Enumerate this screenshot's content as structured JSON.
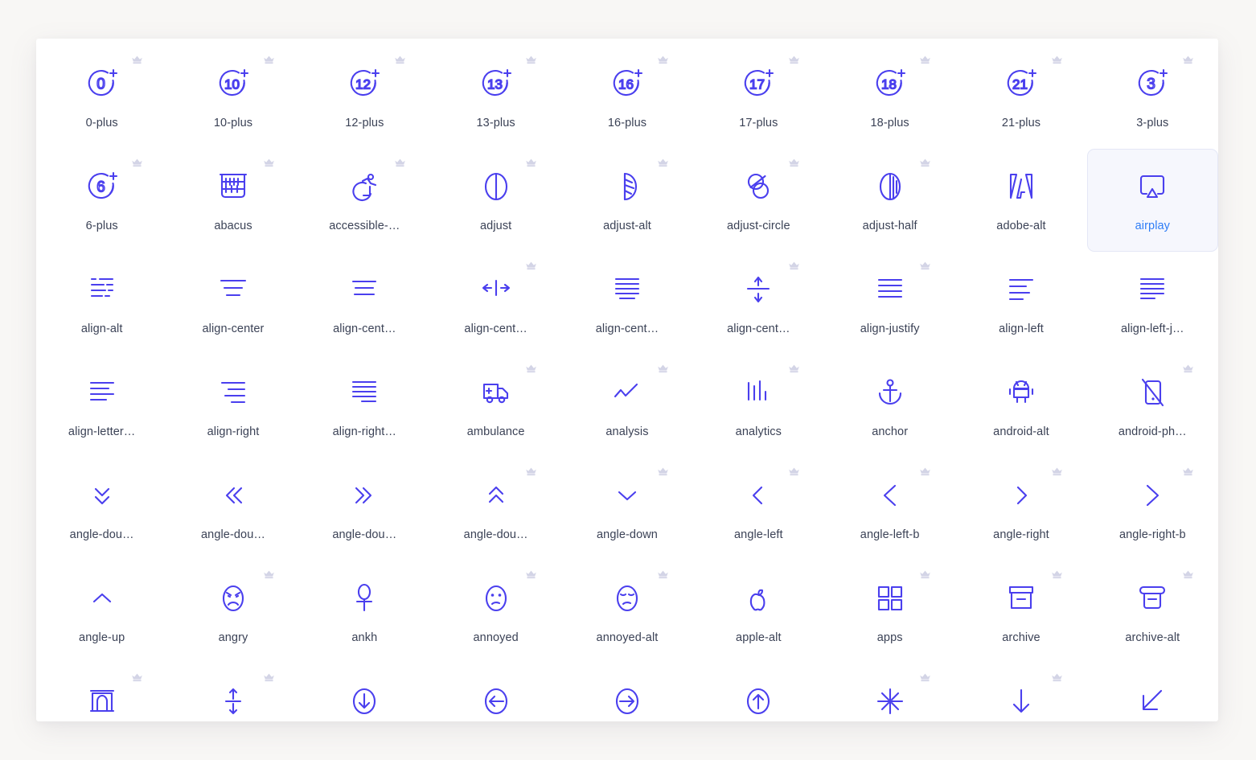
{
  "page": {
    "background_color": "#f8f7f5",
    "card_background": "#ffffff",
    "icon_color": "#4a3fee",
    "label_color": "#3b4256",
    "selected_label_color": "#2f7df6",
    "selected_background": "#f6f7fd",
    "crown_color": "#d3d4e6",
    "columns": 9
  },
  "icons": [
    {
      "label": "0-plus",
      "glyph": "age-plus",
      "value": "0",
      "premium": true,
      "selected": false
    },
    {
      "label": "10-plus",
      "glyph": "age-plus",
      "value": "10",
      "premium": true,
      "selected": false
    },
    {
      "label": "12-plus",
      "glyph": "age-plus",
      "value": "12",
      "premium": true,
      "selected": false
    },
    {
      "label": "13-plus",
      "glyph": "age-plus",
      "value": "13",
      "premium": true,
      "selected": false
    },
    {
      "label": "16-plus",
      "glyph": "age-plus",
      "value": "16",
      "premium": true,
      "selected": false
    },
    {
      "label": "17-plus",
      "glyph": "age-plus",
      "value": "17",
      "premium": true,
      "selected": false
    },
    {
      "label": "18-plus",
      "glyph": "age-plus",
      "value": "18",
      "premium": true,
      "selected": false
    },
    {
      "label": "21-plus",
      "glyph": "age-plus",
      "value": "21",
      "premium": true,
      "selected": false
    },
    {
      "label": "3-plus",
      "glyph": "age-plus",
      "value": "3",
      "premium": true,
      "selected": false
    },
    {
      "label": "6-plus",
      "glyph": "age-plus",
      "value": "6",
      "premium": true,
      "selected": false
    },
    {
      "label": "abacus",
      "glyph": "abacus",
      "premium": true,
      "selected": false
    },
    {
      "label": "accessible-…",
      "glyph": "accessible",
      "premium": true,
      "selected": false
    },
    {
      "label": "adjust",
      "glyph": "adjust",
      "premium": true,
      "selected": false
    },
    {
      "label": "adjust-alt",
      "glyph": "adjust-alt",
      "premium": true,
      "selected": false
    },
    {
      "label": "adjust-circle",
      "glyph": "adjust-circle",
      "premium": true,
      "selected": false
    },
    {
      "label": "adjust-half",
      "glyph": "adjust-half",
      "premium": true,
      "selected": false
    },
    {
      "label": "adobe-alt",
      "glyph": "adobe-alt",
      "premium": false,
      "selected": false
    },
    {
      "label": "airplay",
      "glyph": "airplay",
      "premium": false,
      "selected": true
    },
    {
      "label": "align-alt",
      "glyph": "align-alt",
      "premium": false,
      "selected": false
    },
    {
      "label": "align-center",
      "glyph": "align-center",
      "premium": false,
      "selected": false
    },
    {
      "label": "align-cent…",
      "glyph": "align-center-2",
      "premium": false,
      "selected": false
    },
    {
      "label": "align-cent…",
      "glyph": "align-center-h",
      "premium": true,
      "selected": false
    },
    {
      "label": "align-cent…",
      "glyph": "align-center-justify",
      "premium": false,
      "selected": false
    },
    {
      "label": "align-cent…",
      "glyph": "align-center-v",
      "premium": true,
      "selected": false
    },
    {
      "label": "align-justify",
      "glyph": "align-justify",
      "premium": true,
      "selected": false
    },
    {
      "label": "align-left",
      "glyph": "align-left",
      "premium": false,
      "selected": false
    },
    {
      "label": "align-left-j…",
      "glyph": "align-left-justify",
      "premium": false,
      "selected": false
    },
    {
      "label": "align-letter…",
      "glyph": "align-letter",
      "premium": false,
      "selected": false
    },
    {
      "label": "align-right",
      "glyph": "align-right",
      "premium": false,
      "selected": false
    },
    {
      "label": "align-right…",
      "glyph": "align-right-justify",
      "premium": false,
      "selected": false
    },
    {
      "label": "ambulance",
      "glyph": "ambulance",
      "premium": true,
      "selected": false
    },
    {
      "label": "analysis",
      "glyph": "analysis",
      "premium": true,
      "selected": false
    },
    {
      "label": "analytics",
      "glyph": "analytics",
      "premium": true,
      "selected": false
    },
    {
      "label": "anchor",
      "glyph": "anchor",
      "premium": false,
      "selected": false
    },
    {
      "label": "android-alt",
      "glyph": "android-alt",
      "premium": false,
      "selected": false
    },
    {
      "label": "android-ph…",
      "glyph": "android-phone-slash",
      "premium": true,
      "selected": false
    },
    {
      "label": "angle-dou…",
      "glyph": "angle-double-down",
      "premium": false,
      "selected": false
    },
    {
      "label": "angle-dou…",
      "glyph": "angle-double-left",
      "premium": false,
      "selected": false
    },
    {
      "label": "angle-dou…",
      "glyph": "angle-double-right",
      "premium": false,
      "selected": false
    },
    {
      "label": "angle-dou…",
      "glyph": "angle-double-up",
      "premium": true,
      "selected": false
    },
    {
      "label": "angle-down",
      "glyph": "angle-down",
      "premium": true,
      "selected": false
    },
    {
      "label": "angle-left",
      "glyph": "angle-left",
      "premium": true,
      "selected": false
    },
    {
      "label": "angle-left-b",
      "glyph": "angle-left-b",
      "premium": true,
      "selected": false
    },
    {
      "label": "angle-right",
      "glyph": "angle-right",
      "premium": true,
      "selected": false
    },
    {
      "label": "angle-right-b",
      "glyph": "angle-right-b",
      "premium": true,
      "selected": false
    },
    {
      "label": "angle-up",
      "glyph": "angle-up",
      "premium": false,
      "selected": false
    },
    {
      "label": "angry",
      "glyph": "angry",
      "premium": true,
      "selected": false
    },
    {
      "label": "ankh",
      "glyph": "ankh",
      "premium": false,
      "selected": false
    },
    {
      "label": "annoyed",
      "glyph": "annoyed",
      "premium": true,
      "selected": false
    },
    {
      "label": "annoyed-alt",
      "glyph": "annoyed-alt",
      "premium": true,
      "selected": false
    },
    {
      "label": "apple-alt",
      "glyph": "apple-alt",
      "premium": false,
      "selected": false
    },
    {
      "label": "apps",
      "glyph": "apps",
      "premium": true,
      "selected": false
    },
    {
      "label": "archive",
      "glyph": "archive",
      "premium": true,
      "selected": false
    },
    {
      "label": "archive-alt",
      "glyph": "archive-alt",
      "premium": true,
      "selected": false
    },
    {
      "label": "",
      "glyph": "arch",
      "premium": true,
      "selected": false
    },
    {
      "label": "",
      "glyph": "arrow-resize-v",
      "premium": true,
      "selected": false
    },
    {
      "label": "",
      "glyph": "arrow-circle-down",
      "premium": false,
      "selected": false
    },
    {
      "label": "",
      "glyph": "arrow-circle-left",
      "premium": false,
      "selected": false
    },
    {
      "label": "",
      "glyph": "arrow-circle-right",
      "premium": false,
      "selected": false
    },
    {
      "label": "",
      "glyph": "arrow-circle-up",
      "premium": false,
      "selected": false
    },
    {
      "label": "",
      "glyph": "arrow-compress",
      "premium": true,
      "selected": false
    },
    {
      "label": "",
      "glyph": "arrow-down",
      "premium": true,
      "selected": false
    },
    {
      "label": "",
      "glyph": "arrow-down-left",
      "premium": false,
      "selected": false
    }
  ]
}
